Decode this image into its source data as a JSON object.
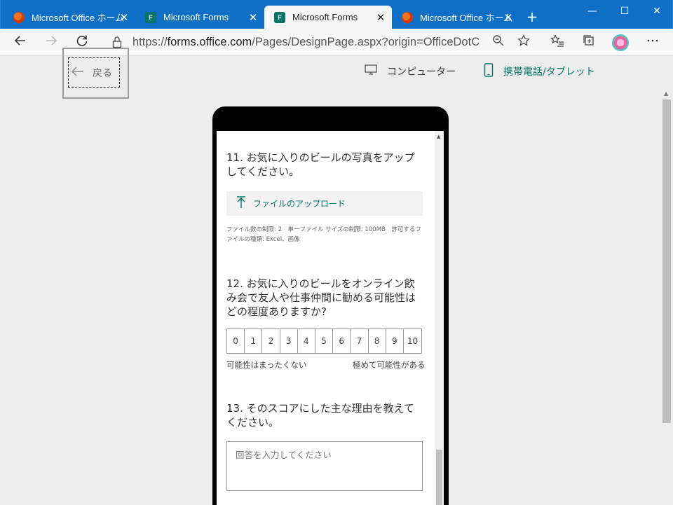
{
  "tabs": [
    {
      "title": "Microsoft Office ホーム",
      "icon": "office-icon",
      "active": false
    },
    {
      "title": "Microsoft Forms",
      "icon": "forms-icon",
      "active": false
    },
    {
      "title": "Microsoft Forms",
      "icon": "forms-icon",
      "active": true
    },
    {
      "title": "Microsoft Office ホーム",
      "icon": "office-icon",
      "active": false
    }
  ],
  "tab_close_glyph": "✕",
  "new_tab_glyph": "+",
  "window_controls": {
    "minimize": "—",
    "maximize": "☐",
    "close": "✕"
  },
  "address": {
    "scheme": "https://",
    "host": "forms.office.com",
    "path": "/Pages/DesignPage.aspx?origin=OfficeDotC..."
  },
  "preview": {
    "back_label": "戻る",
    "desktop_label": "コンピューター",
    "mobile_label": "携帯電話/タブレット",
    "accent": "#077568"
  },
  "form": {
    "q11_title": "11. お気に入りのビールの写真をアップしてください。",
    "upload_label": "ファイルのアップロード",
    "upload_note": "ファイル数の制限: 2　単一ファイル サイズの制限: 100MB　許可するファイルの種類: Excel、画像",
    "q12_title": "12. お気に入りのビールをオンライン飲み会で友人や仕事仲間に勧める可能性はどの程度ありますか?",
    "scale": [
      "0",
      "1",
      "2",
      "3",
      "4",
      "5",
      "6",
      "7",
      "8",
      "9",
      "10"
    ],
    "scale_low": "可能性はまったくない",
    "scale_high": "極めて可能性がある",
    "q13_title": "13. そのスコアにした主な理由を教えてください。",
    "answer_placeholder": "回答を入力してください"
  }
}
